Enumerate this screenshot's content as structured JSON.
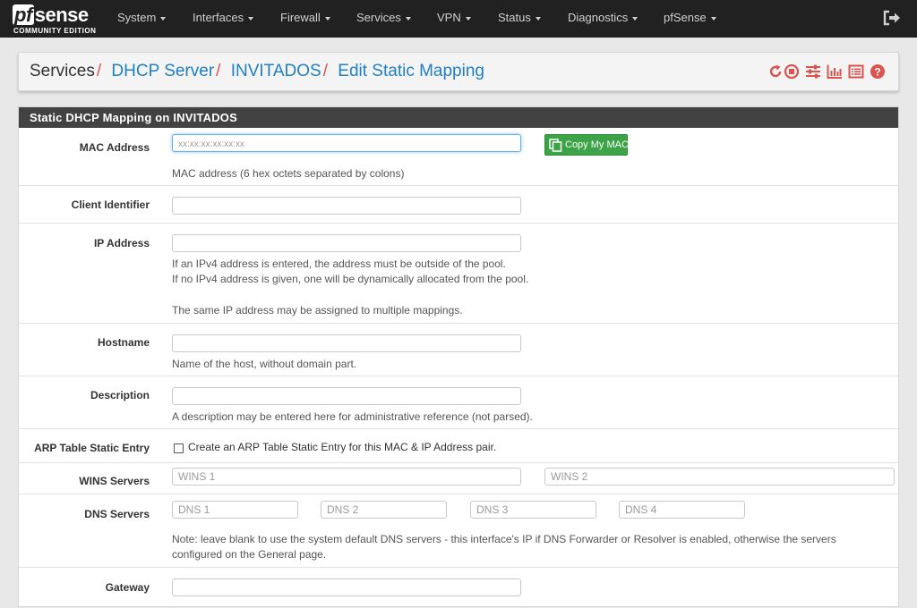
{
  "brand": {
    "logo_pf": "pf",
    "logo_rest": "sense",
    "edition": "COMMUNITY EDITION"
  },
  "nav": {
    "items": [
      {
        "label": "System"
      },
      {
        "label": "Interfaces"
      },
      {
        "label": "Firewall"
      },
      {
        "label": "Services"
      },
      {
        "label": "VPN"
      },
      {
        "label": "Status"
      },
      {
        "label": "Diagnostics"
      },
      {
        "label": "pfSense"
      }
    ],
    "logout_icon": "sign-out-icon"
  },
  "breadcrumb": {
    "items": [
      "Services",
      "DHCP Server",
      "INVITADOS",
      "Edit Static Mapping"
    ],
    "separator": "/",
    "icons": [
      "restart-icon",
      "stop-icon",
      "settings-sliders-icon",
      "chart-icon",
      "log-list-icon",
      "help-icon"
    ],
    "icon_color": "#d9534f",
    "link_color": "#1f7fc5"
  },
  "panel": {
    "title": "Static DHCP Mapping on INVITADOS",
    "mac": {
      "label": "MAC Address",
      "placeholder": "xx:xx:xx:xx:xx:xx",
      "button": "Copy My MAC",
      "help": "MAC address (6 hex octets separated by colons)"
    },
    "client_id": {
      "label": "Client Identifier"
    },
    "ip": {
      "label": "IP Address",
      "help1": "If an IPv4 address is entered, the address must be outside of the pool.",
      "help2": "If no IPv4 address is given, one will be dynamically allocated from the pool.",
      "help3": "The same IP address may be assigned to multiple mappings."
    },
    "hostname": {
      "label": "Hostname",
      "help": "Name of the host, without domain part."
    },
    "description": {
      "label": "Description",
      "help": "A description may be entered here for administrative reference (not parsed)."
    },
    "arp": {
      "label": "ARP Table Static Entry",
      "checkbox_label": "Create an ARP Table Static Entry for this MAC & IP Address pair.",
      "checked": false
    },
    "wins": {
      "label": "WINS Servers",
      "placeholder1": "WINS 1",
      "placeholder2": "WINS 2"
    },
    "dns": {
      "label": "DNS Servers",
      "placeholders": [
        "DNS 1",
        "DNS 2",
        "DNS 3",
        "DNS 4"
      ],
      "note": "Note: leave blank to use the system default DNS servers - this interface's IP if DNS Forwarder or Resolver is enabled, otherwise the servers configured on the General page."
    },
    "gateway": {
      "label": "Gateway"
    }
  },
  "colors": {
    "navbar": "#212121",
    "panel_heading": "#424242",
    "button_green": "#3ca347",
    "accent_red": "#d9534f"
  }
}
